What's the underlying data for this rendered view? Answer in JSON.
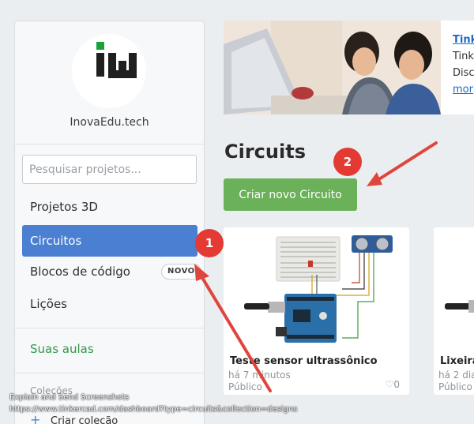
{
  "sidebar": {
    "username": "InovaEdu.tech",
    "search_placeholder": "Pesquisar projetos...",
    "items": [
      {
        "label": "Projetos 3D"
      },
      {
        "label": "Circuitos"
      },
      {
        "label": "Blocos de código",
        "badge": "NOVO"
      },
      {
        "label": "Lições"
      }
    ],
    "classes_label": "Suas aulas",
    "collections_label": "Coleções",
    "create_collection_label": "Criar coleção"
  },
  "banner": {
    "title_link": "Tink",
    "line2": "Tink",
    "line3": "Disc",
    "more_link": "mor"
  },
  "main": {
    "title": "Circuits",
    "create_button": "Criar novo Circuito"
  },
  "cards": [
    {
      "title": "Teste sensor ultrassônico",
      "time": "há 7 minutos",
      "visibility": "Público",
      "likes": "0"
    },
    {
      "title": "Lixeira",
      "time": "há 2 dia",
      "visibility": "Público"
    }
  ],
  "annotations": [
    {
      "number": "1"
    },
    {
      "number": "2"
    }
  ],
  "status": {
    "app": "Explain and Send Screenshots",
    "url": "https://www.tinkercad.com/dashboard?type=circuits&collection=designs"
  },
  "colors": {
    "accent_blue": "#4a7fd1",
    "create_green": "#6bb159",
    "annotation_red": "#e33b34",
    "classes_green": "#2f9a4c"
  }
}
